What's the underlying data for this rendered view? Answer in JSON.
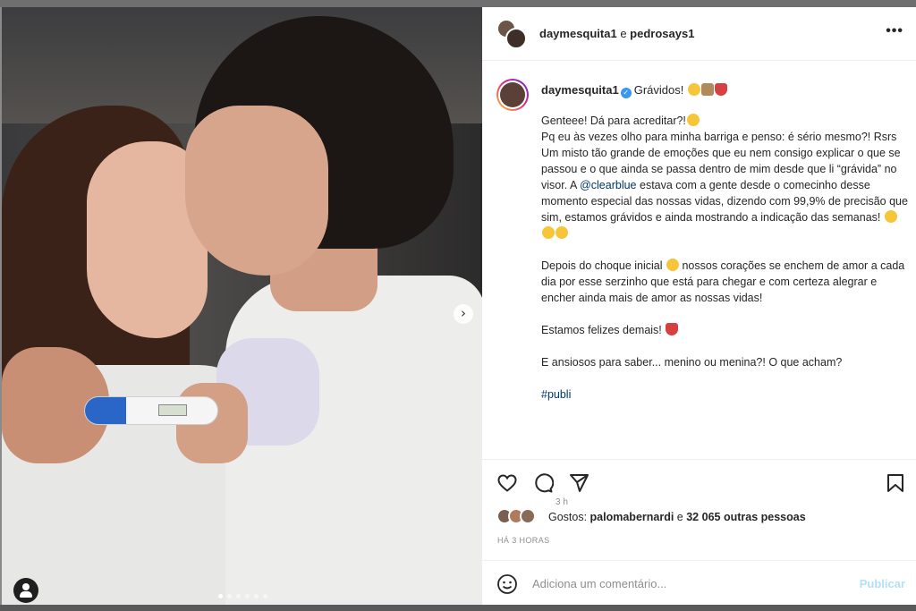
{
  "post": {
    "header_user1": "daymesquita1",
    "header_sep": " e ",
    "header_user2": "pedrosays1",
    "more": "•••"
  },
  "caption": {
    "username": "daymesquita1",
    "title": "Grávidos!",
    "lines": [
      "Genteee! Dá para acreditar?!",
      "Pq eu às vezes olho para minha barriga e penso: é sério mesmo?! Rsrs",
      "Um misto tão grande de emoções que eu nem consigo explicar o que se passou e o que ainda se passa dentro de mim desde que li “grávida” no visor. A ",
      "@clearblue",
      " estava com a gente desde o comecinho desse momento especial das nossas vidas, dizendo com 99,9% de precisão que sim, estamos grávidos e ainda mostrando a indicação das semanas!",
      "Depois do choque inicial",
      " nossos corações se enchem de amor a cada dia por esse serzinho que está para chegar e com certeza alegrar e encher ainda mais de amor as nossas vidas!",
      "Estamos felizes demais!",
      "E ansiosos para saber... menino ou menina?! O que acham?",
      "#publi"
    ],
    "time": "3 h"
  },
  "likes": {
    "prefix": "Gostos: ",
    "user": "palomabernardi",
    "mid": " e ",
    "count": "32 065 outras pessoas"
  },
  "ago": "HÁ 3 HORAS",
  "comment": {
    "placeholder": "Adiciona um comentário...",
    "publish": "Publicar"
  },
  "icons": {
    "next": "chevron-right-icon",
    "like": "heart-icon",
    "comment": "comment-icon",
    "share": "send-icon",
    "save": "bookmark-icon",
    "emoji": "smiley-icon",
    "tagged": "user-icon"
  },
  "colors": {
    "link": "#00376b",
    "verified": "#3897f0",
    "publish": "#b2dffc",
    "heart_emoji": "#d64040"
  },
  "carousel": {
    "count": 6,
    "active": 1
  }
}
